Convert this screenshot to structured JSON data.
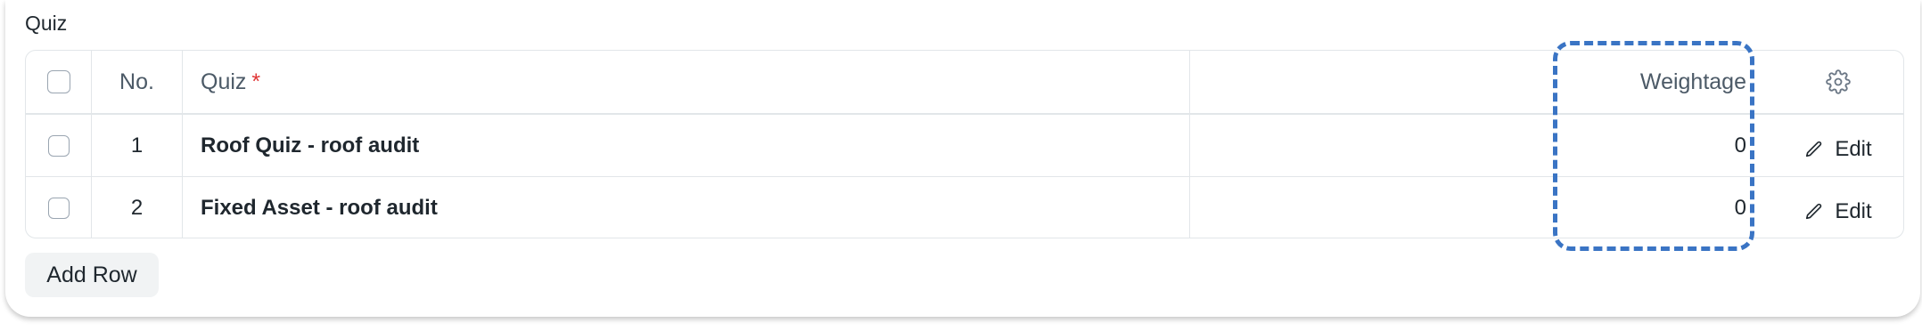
{
  "section": {
    "label": "Quiz"
  },
  "table": {
    "headers": {
      "no": "No.",
      "quiz": "Quiz",
      "required_mark": "*",
      "weightage": "Weightage"
    },
    "rows": [
      {
        "no": "1",
        "quiz": "Roof Quiz - roof audit",
        "weightage": "0",
        "action": "Edit"
      },
      {
        "no": "2",
        "quiz": "Fixed Asset - roof audit",
        "weightage": "0",
        "action": "Edit"
      }
    ]
  },
  "buttons": {
    "add_row": "Add Row"
  },
  "icons": {
    "settings": "gear-icon",
    "edit": "pencil-icon"
  },
  "colors": {
    "highlight": "#3a74c4",
    "required": "#e03636"
  }
}
